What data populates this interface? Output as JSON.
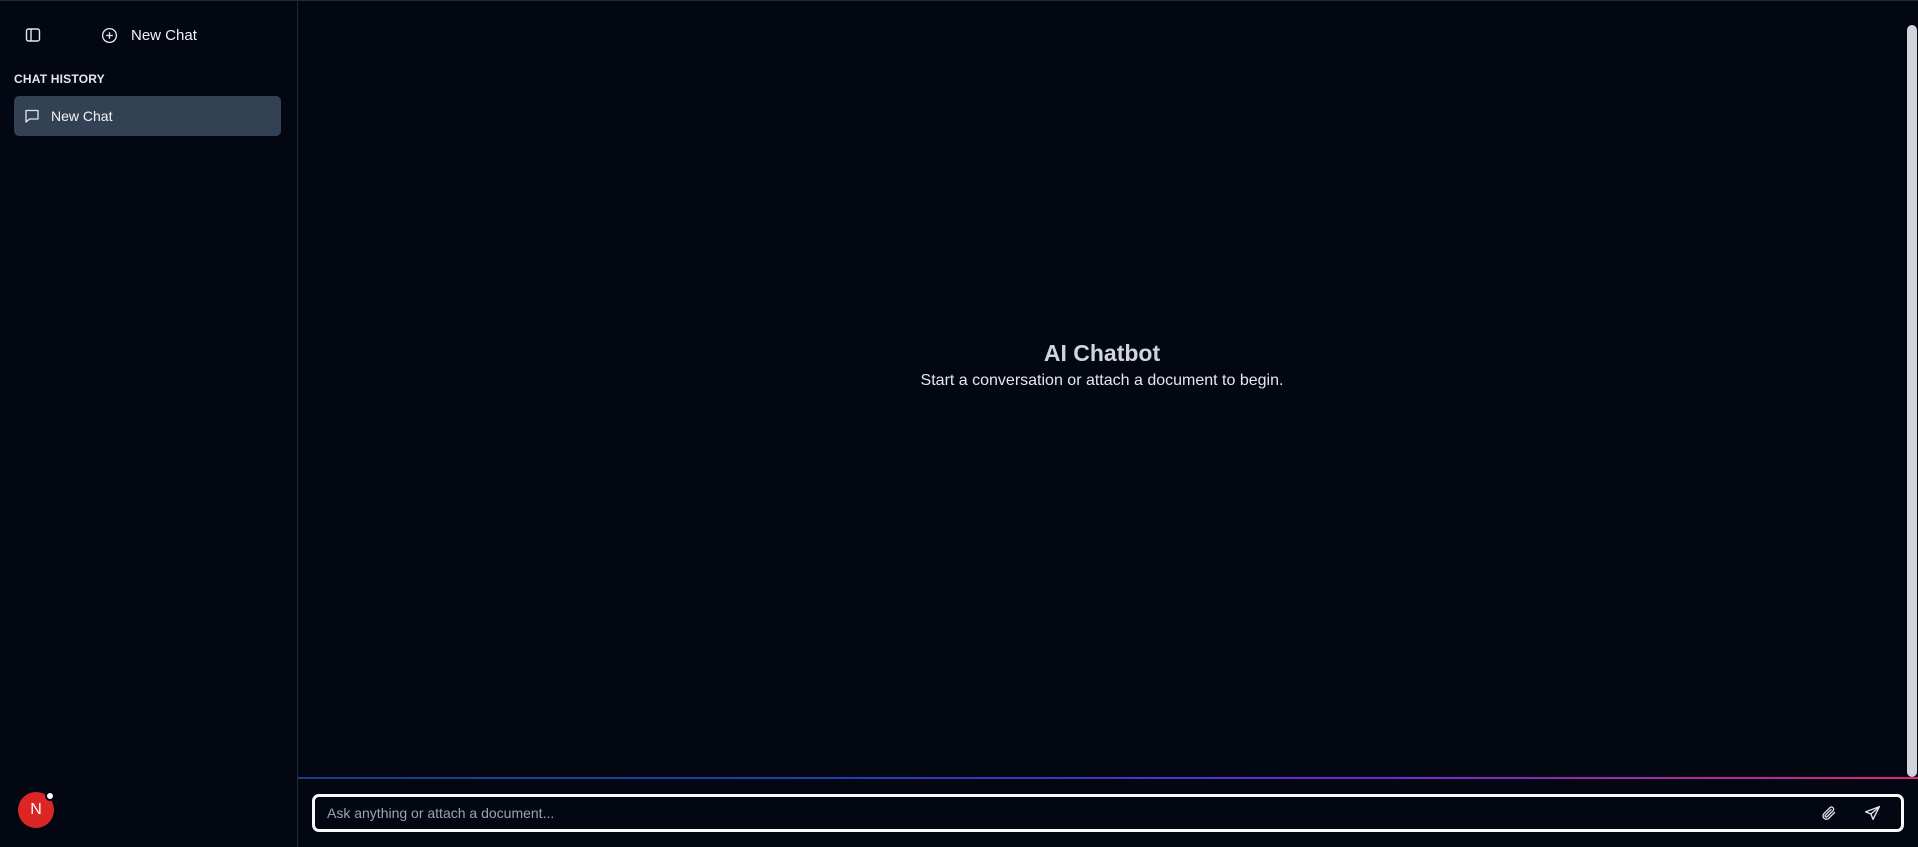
{
  "sidebar": {
    "toggle_icon": "sidebar-toggle-icon",
    "new_chat_label": "New Chat",
    "new_chat_icon": "plus-circle-icon",
    "history_title": "Chat History",
    "items": [
      {
        "label": "New Chat",
        "icon": "message-square-icon"
      }
    ]
  },
  "user": {
    "initial": "N",
    "avatar_color": "#dc2626"
  },
  "main": {
    "title": "AI Chatbot",
    "subtitle": "Start a conversation or attach a document to begin."
  },
  "composer": {
    "placeholder": "Ask anything or attach a document...",
    "attach_icon": "paperclip-icon",
    "send_icon": "send-icon"
  },
  "colors": {
    "background": "#030712",
    "history_item_active": "#334155",
    "accent_gradient": [
      "#1e3a8a",
      "#6d28d9",
      "#db2777"
    ]
  }
}
